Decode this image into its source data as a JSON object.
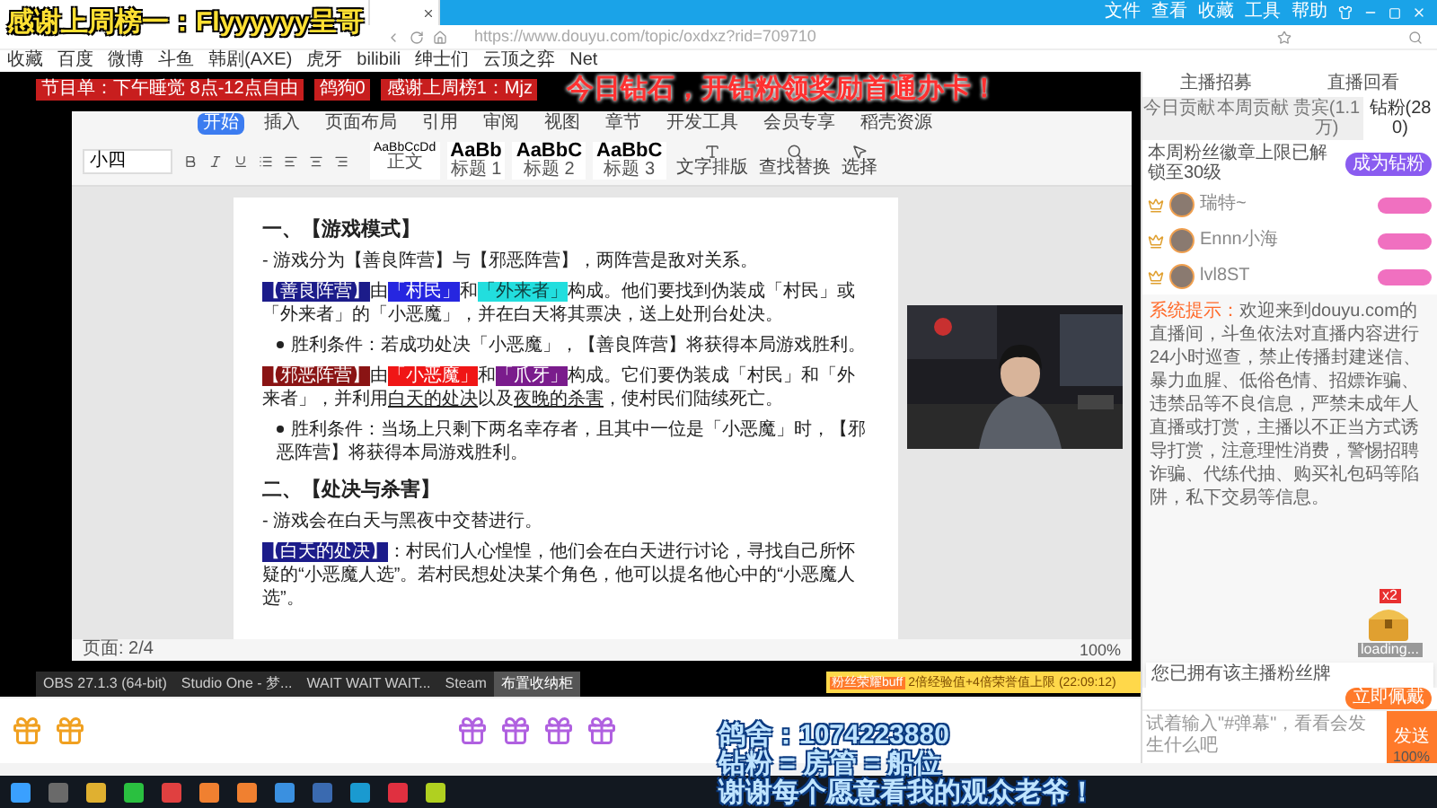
{
  "overlay": {
    "top_banner": "感谢上周榜一：Flyyyyyy呈哥",
    "diamond_banner": "今日钻石，开钻粉领奖励首通办卡！",
    "left_tags": [
      "节目单：下午睡觉 8点-12点自由",
      "鸽狗0",
      "感谢上周榜1：Mjz"
    ],
    "bottom_lines": [
      "鸽舍：1074223880",
      "钻粉 = 房管 = 船位",
      "谢谢每个愿意看我的观众老爷！"
    ]
  },
  "browser": {
    "menu": [
      "文件",
      "查看",
      "收藏",
      "工具",
      "帮助"
    ],
    "url": "https://www.douyu.com/topic/oxdxz?rid=709710",
    "bookmarks": [
      "收藏",
      "百度",
      "微博",
      "斗鱼",
      "韩剧(AXE)",
      "虎牙",
      "bilibili",
      "绅士们",
      "云顶之弈",
      "Net"
    ],
    "zoom": "100%"
  },
  "ribbon": {
    "tabs": [
      {
        "label": "开始",
        "selected": true
      },
      {
        "label": "插入",
        "selected": false
      },
      {
        "label": "页面布局",
        "selected": false
      },
      {
        "label": "引用",
        "selected": false
      },
      {
        "label": "审阅",
        "selected": false
      },
      {
        "label": "视图",
        "selected": false
      },
      {
        "label": "章节",
        "selected": false
      },
      {
        "label": "开发工具",
        "selected": false
      },
      {
        "label": "会员专享",
        "selected": false
      },
      {
        "label": "稻壳资源",
        "selected": false
      }
    ],
    "font_size": "小四",
    "styles": [
      {
        "sample": "AaBbCcDd",
        "name": "正文"
      },
      {
        "sample": "AaBb",
        "name": "标题 1"
      },
      {
        "sample": "AaBbC",
        "name": "标题 2"
      },
      {
        "sample": "AaBbC",
        "name": "标题 3"
      }
    ],
    "tools": [
      "文字排版",
      "查找替换",
      "选择"
    ]
  },
  "document": {
    "paragraphs": [
      {
        "kind": "heading",
        "segments": [
          {
            "text": "一、【游戏模式】"
          }
        ]
      },
      {
        "kind": "text",
        "segments": [
          {
            "text": "- 游戏分为【善良阵营】与【邪恶阵营】，两阵营是敌对关系。"
          }
        ]
      },
      {
        "kind": "text",
        "segments": [
          {
            "text": "【善良阵营】",
            "color": "#1c1c8a"
          },
          {
            "text": "由"
          },
          {
            "text": "「村民」",
            "color": "#2626e0"
          },
          {
            "text": "和"
          },
          {
            "text": "「外来者」",
            "color": "#22dede"
          },
          {
            "text": "构成。他们要找到伪装成「村民」或「外来者」的「小恶魔」，并在白天将其票决，送上处刑台处决。"
          }
        ]
      },
      {
        "kind": "bullet",
        "segments": [
          {
            "text": "胜利条件：若成功处决「小恶魔」，【善良阵营】将获得本局游戏胜利。"
          }
        ]
      },
      {
        "kind": "text",
        "segments": [
          {
            "text": "【邪恶阵营】",
            "color": "#8a1414"
          },
          {
            "text": "由"
          },
          {
            "text": "「小恶魔」",
            "color": "#f01616"
          },
          {
            "text": "和"
          },
          {
            "text": "「爪牙」",
            "color": "#7a1c8c"
          },
          {
            "text": "构成。它们要伪装成「村民」和「外来者」，并利用"
          },
          {
            "text": "白天的处决",
            "underline": true
          },
          {
            "text": "以及"
          },
          {
            "text": "夜晚的杀害",
            "underline": true
          },
          {
            "text": "，使村民们陆续死亡。"
          }
        ]
      },
      {
        "kind": "bullet",
        "segments": [
          {
            "text": "胜利条件：当场上只剩下两名幸存者，且其中一位是「小恶魔」时，【邪恶阵营】将获得本局游戏胜利。"
          }
        ]
      },
      {
        "kind": "heading",
        "segments": [
          {
            "text": "二、【处决与杀害】"
          }
        ]
      },
      {
        "kind": "text",
        "segments": [
          {
            "text": "- 游戏会在白天与黑夜中交替进行。"
          }
        ]
      },
      {
        "kind": "text",
        "segments": [
          {
            "text": "【白天的处决】",
            "color": "#1c1c8a"
          },
          {
            "text": "：村民们人心惶惶，他们会在白天进行讨论，寻找自己所怀疑的“小恶魔人选”。若村民想处决某个角色，他可以提名他心中的“小恶魔人选”。"
          }
        ]
      }
    ],
    "status": "页面: 2/4",
    "zoom": "100%"
  },
  "stream_taskbar": [
    {
      "label": "OBS 27.1.3 (64-bit)",
      "selected": false
    },
    {
      "label": "Studio One - 梦...",
      "selected": false
    },
    {
      "label": "WAIT WAIT WAIT...",
      "selected": false
    },
    {
      "label": "Steam",
      "selected": false
    },
    {
      "label": "布置收纳柜",
      "selected": true
    }
  ],
  "notification": {
    "tag": "粉丝荣耀buff",
    "text": "2倍经验值+4倍荣誉值上限",
    "time": "(22:09:12)"
  },
  "side": {
    "links": [
      "主播招募",
      "直播回看"
    ],
    "tabs": [
      {
        "label": "今日贡献",
        "selected": false
      },
      {
        "label": "本周贡献",
        "selected": false
      },
      {
        "label": "贵宾(1.1万)",
        "selected": false
      },
      {
        "label": "钻粉(280)",
        "selected": true
      }
    ],
    "notice": "本周粉丝徽章上限已解锁至30级",
    "join_button": "成为钻粉",
    "ranks": [
      {
        "name": "瑞特~"
      },
      {
        "name": "Ennn小海"
      },
      {
        "name": "lvl8ST"
      }
    ],
    "system_label": "系统提示：",
    "system_text": "欢迎来到douyu.com的直播间，斗鱼依法对直播内容进行24小时巡查，禁止传播封建迷信、暴力血腥、低俗色情、招嫖诈骗、违禁品等不良信息，严禁未成年人直播或打赏，主播以不正当方式诱导打赏，注意理性消费，警惕招聘诈骗、代练代抽、购买礼包码等陷阱，私下交易等信息。",
    "chest_count": "x2",
    "chest_status": "loading...",
    "popup_text": "您已拥有该主播粉丝牌",
    "popup_button": "立即佩戴",
    "input_placeholder": "试着输入\"#弹幕\"，看看会发生什么吧",
    "send": "发送"
  }
}
